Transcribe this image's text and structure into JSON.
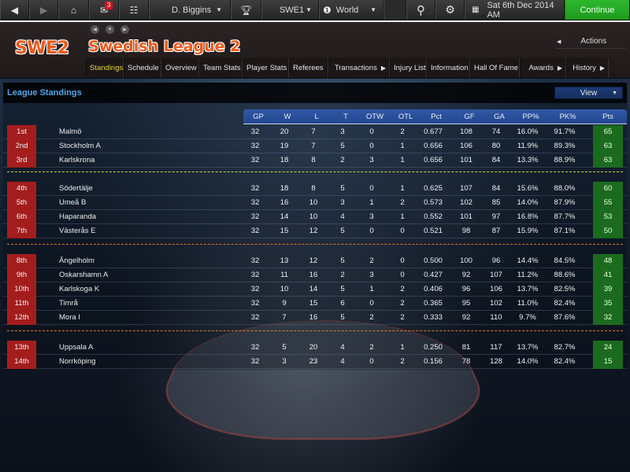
{
  "topbar": {
    "back_icon": "back-arrow-icon",
    "forward_icon": "forward-arrow-icon",
    "home_icon": "home-icon",
    "mail_icon": "mail-icon",
    "mail_badge": "3",
    "club_icon": "club-icon",
    "manager": "D. Biggins",
    "trophy_icon": "trophy-icon",
    "league": "SWE1",
    "world_icon": "world-icon",
    "world": "World",
    "search_icon": "search-icon",
    "gear_icon": "gear-icon",
    "calendar_icon": "calendar-icon",
    "date": "Sat 6th Dec 2014 AM",
    "continue_label": "Continue"
  },
  "header": {
    "abbr": "SWE2",
    "title": "Swedish League 2",
    "actions_label": "Actions",
    "tabs": [
      {
        "label": "Standings",
        "active": true
      },
      {
        "label": "Schedule"
      },
      {
        "label": "Overview"
      },
      {
        "label": "Team Stats"
      },
      {
        "label": "Player Stats"
      },
      {
        "label": "Referees"
      },
      {
        "label": "Transactions",
        "submenu": true
      },
      {
        "label": "Injury List"
      },
      {
        "label": "Information"
      },
      {
        "label": "Hall Of Fame"
      },
      {
        "label": "Awards",
        "submenu": true
      },
      {
        "label": "History",
        "submenu": true
      }
    ]
  },
  "standings": {
    "title": "League Standings",
    "view_label": "View",
    "columns": [
      "GP",
      "W",
      "L",
      "T",
      "OTW",
      "OTL",
      "Pct",
      "GF",
      "GA",
      "PP%",
      "PK%",
      "Pts"
    ],
    "rows": [
      {
        "rank": "1st",
        "team": "Malmö",
        "gp": "32",
        "w": "20",
        "l": "7",
        "t": "3",
        "otw": "0",
        "otl": "2",
        "pct": "0.677",
        "gf": "108",
        "ga": "74",
        "pp": "16.0%",
        "pk": "91.7%",
        "pts": "65"
      },
      {
        "rank": "2nd",
        "team": "Stockholm A",
        "gp": "32",
        "w": "19",
        "l": "7",
        "t": "5",
        "otw": "0",
        "otl": "1",
        "pct": "0.656",
        "gf": "106",
        "ga": "80",
        "pp": "11.9%",
        "pk": "89.3%",
        "pts": "63"
      },
      {
        "rank": "3rd",
        "team": "Karlskrona",
        "gp": "32",
        "w": "18",
        "l": "8",
        "t": "2",
        "otw": "3",
        "otl": "1",
        "pct": "0.656",
        "gf": "101",
        "ga": "84",
        "pp": "13.3%",
        "pk": "88.9%",
        "pts": "63"
      },
      {
        "rank": "4th",
        "team": "Södertälje",
        "gp": "32",
        "w": "18",
        "l": "8",
        "t": "5",
        "otw": "0",
        "otl": "1",
        "pct": "0.625",
        "gf": "107",
        "ga": "84",
        "pp": "15.6%",
        "pk": "88.0%",
        "pts": "60"
      },
      {
        "rank": "5th",
        "team": "Umeå B",
        "gp": "32",
        "w": "16",
        "l": "10",
        "t": "3",
        "otw": "1",
        "otl": "2",
        "pct": "0.573",
        "gf": "102",
        "ga": "85",
        "pp": "14.0%",
        "pk": "87.9%",
        "pts": "55"
      },
      {
        "rank": "6th",
        "team": "Haparanda",
        "gp": "32",
        "w": "14",
        "l": "10",
        "t": "4",
        "otw": "3",
        "otl": "1",
        "pct": "0.552",
        "gf": "101",
        "ga": "97",
        "pp": "16.8%",
        "pk": "87.7%",
        "pts": "53"
      },
      {
        "rank": "7th",
        "team": "Västerås E",
        "gp": "32",
        "w": "15",
        "l": "12",
        "t": "5",
        "otw": "0",
        "otl": "0",
        "pct": "0.521",
        "gf": "98",
        "ga": "87",
        "pp": "15.9%",
        "pk": "87.1%",
        "pts": "50"
      },
      {
        "rank": "8th",
        "team": "Ängelholm",
        "gp": "32",
        "w": "13",
        "l": "12",
        "t": "5",
        "otw": "2",
        "otl": "0",
        "pct": "0.500",
        "gf": "100",
        "ga": "96",
        "pp": "14.4%",
        "pk": "84.5%",
        "pts": "48"
      },
      {
        "rank": "9th",
        "team": "Oskarshamn A",
        "gp": "32",
        "w": "11",
        "l": "16",
        "t": "2",
        "otw": "3",
        "otl": "0",
        "pct": "0.427",
        "gf": "92",
        "ga": "107",
        "pp": "11.2%",
        "pk": "88.6%",
        "pts": "41"
      },
      {
        "rank": "10th",
        "team": "Karlskoga K",
        "gp": "32",
        "w": "10",
        "l": "14",
        "t": "5",
        "otw": "1",
        "otl": "2",
        "pct": "0.406",
        "gf": "96",
        "ga": "106",
        "pp": "13.7%",
        "pk": "82.5%",
        "pts": "39"
      },
      {
        "rank": "11th",
        "team": "Timrå",
        "gp": "32",
        "w": "9",
        "l": "15",
        "t": "6",
        "otw": "0",
        "otl": "2",
        "pct": "0.365",
        "gf": "95",
        "ga": "102",
        "pp": "11.0%",
        "pk": "82.4%",
        "pts": "35"
      },
      {
        "rank": "12th",
        "team": "Mora I",
        "gp": "32",
        "w": "7",
        "l": "16",
        "t": "5",
        "otw": "2",
        "otl": "2",
        "pct": "0.333",
        "gf": "92",
        "ga": "110",
        "pp": "9.7%",
        "pk": "87.6%",
        "pts": "32"
      },
      {
        "rank": "13th",
        "team": "Uppsala A",
        "gp": "32",
        "w": "5",
        "l": "20",
        "t": "4",
        "otw": "2",
        "otl": "1",
        "pct": "0.250",
        "gf": "81",
        "ga": "117",
        "pp": "13.7%",
        "pk": "82.7%",
        "pts": "24"
      },
      {
        "rank": "14th",
        "team": "Norrköping",
        "gp": "32",
        "w": "3",
        "l": "23",
        "t": "4",
        "otw": "0",
        "otl": "2",
        "pct": "0.156",
        "gf": "78",
        "ga": "128",
        "pp": "14.0%",
        "pk": "82.4%",
        "pts": "15"
      }
    ],
    "colors": {
      "rank_bg": "#a41d1d",
      "pts_bg": "#1b6b1e",
      "header_bg": "#2a50a0",
      "playoff_divider": "#c8d13a",
      "relegation_divider": "#e07a1f",
      "title_color": "#4fa6ea",
      "continue_bg": "#22a822"
    }
  }
}
